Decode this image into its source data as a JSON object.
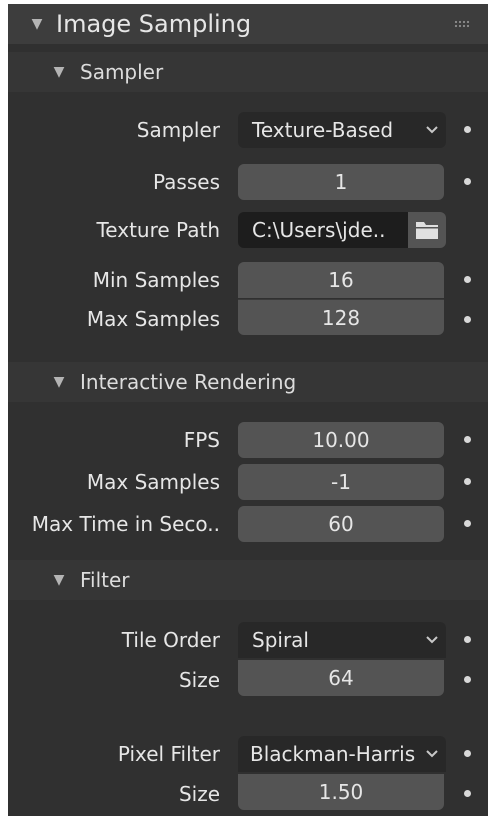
{
  "panel": {
    "title": "Image Sampling",
    "collapse_icon": "triangle-down-icon",
    "drag_handle_icon": "grip-dots-icon"
  },
  "sampler": {
    "title": "Sampler",
    "fields": {
      "sampler": {
        "label": "Sampler",
        "value": "Texture-Based"
      },
      "passes": {
        "label": "Passes",
        "value": "1"
      },
      "texture_path": {
        "label": "Texture Path",
        "value": "C:\\Users\\jde.."
      },
      "min_samples": {
        "label": "Min Samples",
        "value": "16"
      },
      "max_samples": {
        "label": "Max Samples",
        "value": "128"
      }
    }
  },
  "interactive": {
    "title": "Interactive Rendering",
    "fields": {
      "fps": {
        "label": "FPS",
        "value": "10.00"
      },
      "max_samples": {
        "label": "Max Samples",
        "value": "-1"
      },
      "max_time": {
        "label": "Max Time in Seco..",
        "value": "60"
      }
    }
  },
  "filter": {
    "title": "Filter",
    "fields": {
      "tile_order": {
        "label": "Tile Order",
        "value": "Spiral"
      },
      "tile_size": {
        "label": "Size",
        "value": "64"
      },
      "pixel_filter": {
        "label": "Pixel Filter",
        "value": "Blackman-Harris"
      },
      "filter_size": {
        "label": "Size",
        "value": "1.50"
      }
    }
  },
  "colors": {
    "panel_bg": "#303030",
    "header_bg": "#3d3d3d",
    "field_bg": "#545454",
    "dropdown_bg": "#282828",
    "text": "#e6e6e6",
    "folder_icon": "#e0e0e0"
  }
}
